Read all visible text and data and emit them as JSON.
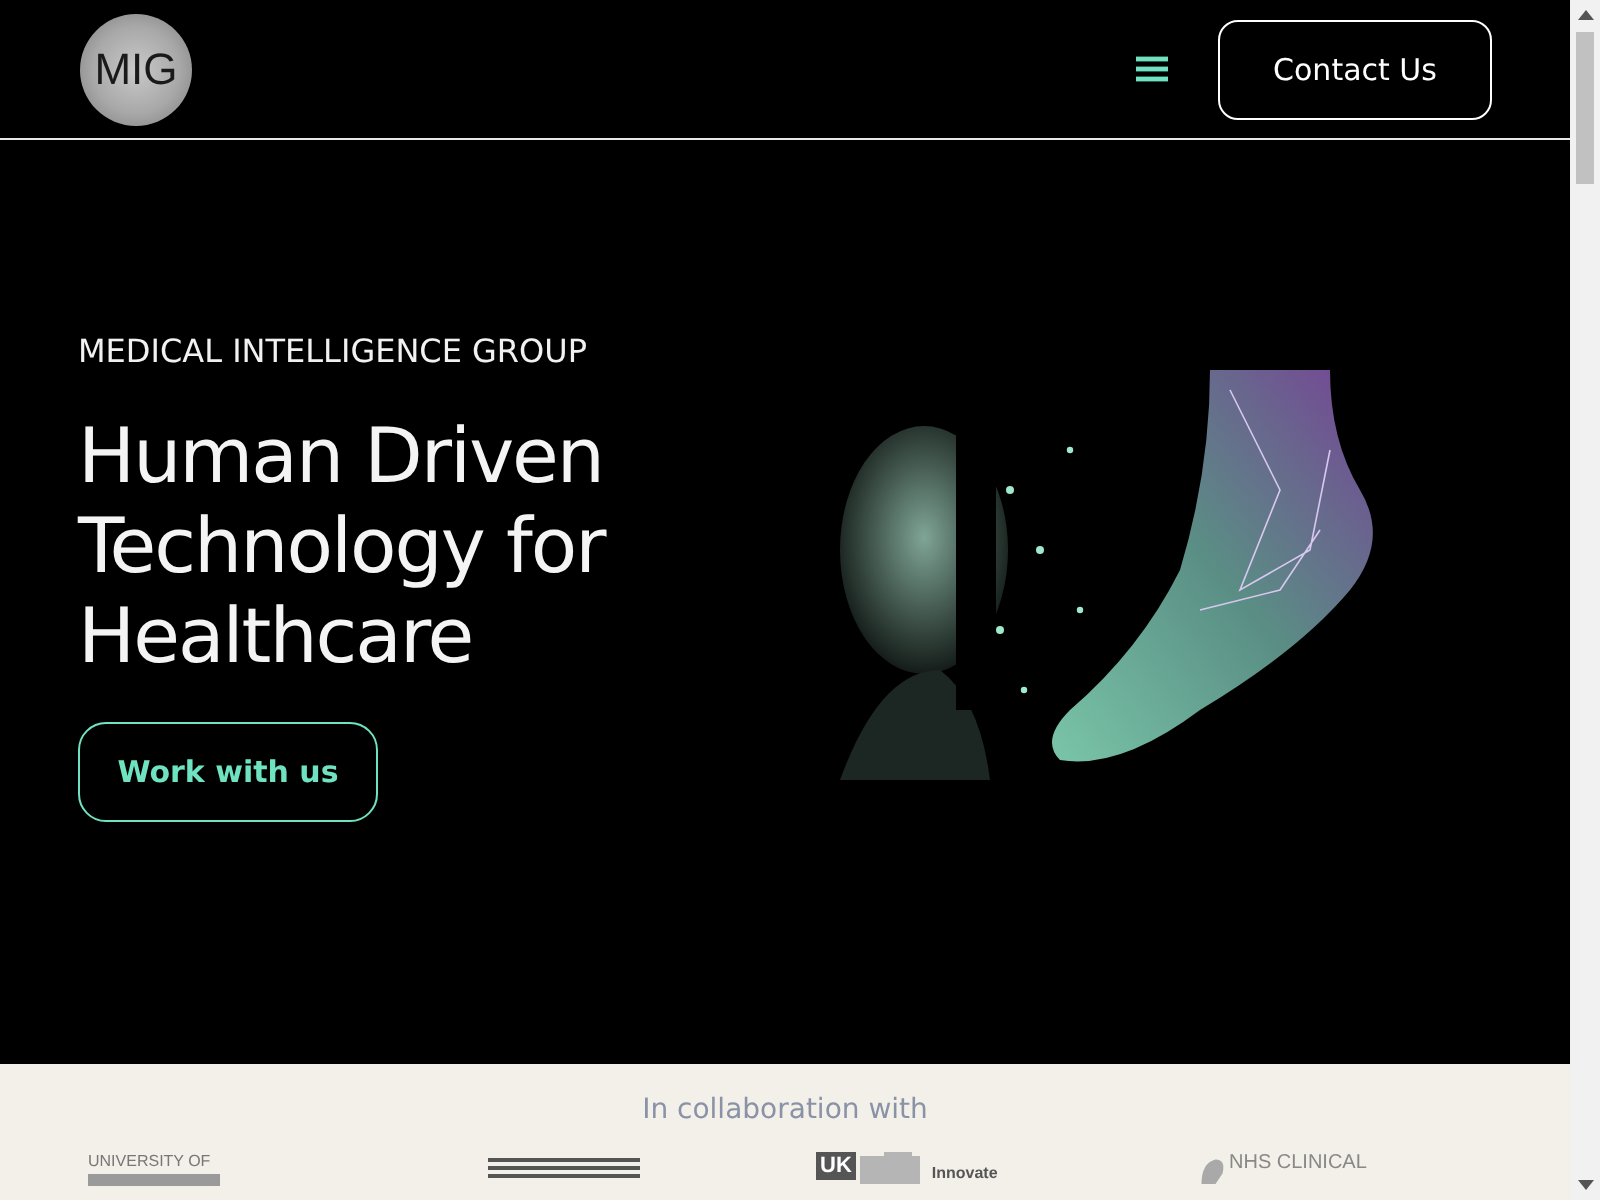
{
  "header": {
    "logo_text": "MIG",
    "contact_button": "Contact Us"
  },
  "hero": {
    "eyebrow": "MEDICAL INTELLIGENCE GROUP",
    "title": "Human Driven Technology for Healthcare",
    "button": "Work with us"
  },
  "partners": {
    "heading": "In collaboration with",
    "logos": [
      {
        "kind": "oxford",
        "text": "UNIVERSITY OF"
      },
      {
        "kind": "bars"
      },
      {
        "kind": "innovate",
        "badge": "UK",
        "text": "Innovate"
      },
      {
        "kind": "nhs",
        "text": "NHS CLINICAL"
      }
    ]
  }
}
